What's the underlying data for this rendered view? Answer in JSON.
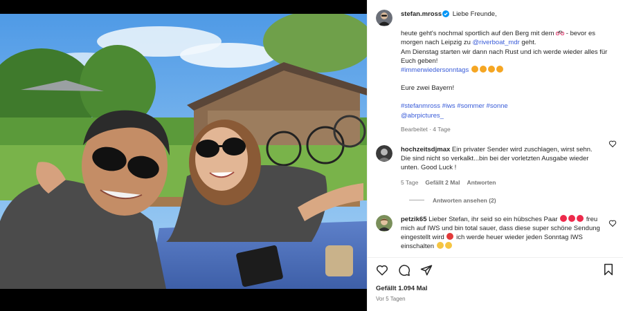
{
  "caption": {
    "username": "stefan.mross",
    "greeting": "Liebe Freunde,",
    "line1a": "heute geht's nochmal sportlich auf den Berg mit dem",
    "line1b": "- bevor es morgen nach Leipzig zu",
    "mention": "@riverboat_mdr",
    "line1c": "geht.",
    "line2": "Am Dienstag starten wir dann nach Rust und ich werde wieder alles für Euch geben!",
    "hashtag1": "#immerwiedersonntags",
    "signoff": "Eure zwei Bayern!",
    "tags": "#stefanmross #iws #sommer #sonne",
    "credit": "@abrpictures_",
    "meta": "Bearbeitet · 4 Tage"
  },
  "comments": [
    {
      "username": "hochzeitsdjmax",
      "text": "Ein privater Sender wird zuschlagen, wirst sehn. Die sind nicht so verkalkt...bin bei der vorletzten Ausgabe wieder unten. Good Luck !",
      "time": "5 Tage",
      "likes": "Gefällt 2 Mal",
      "reply": "Antworten",
      "view_replies": "Antworten ansehen (2)"
    },
    {
      "username": "petzik65",
      "text_a": "Lieber Stefan, ihr seid so ein hübsches Paar",
      "text_b": "freu mich auf IWS und bin total sauer, dass diese super schöne Sendung eingestellt wird",
      "text_c": "ich werde heuer wieder jeden Sonntag IWS einschalten"
    }
  ],
  "footer": {
    "likes": "Gefällt 1.094 Mal",
    "date": "Vor 5 Tagen"
  },
  "icons": {
    "like": "heart-icon",
    "comment": "comment-icon",
    "share": "send-icon",
    "save": "bookmark-icon",
    "verified": "verified-badge-icon"
  },
  "colors": {
    "link": "#385bd8",
    "verified": "#0095f6",
    "heart_emoji": "#ed2a4b",
    "muted": "#737373"
  }
}
